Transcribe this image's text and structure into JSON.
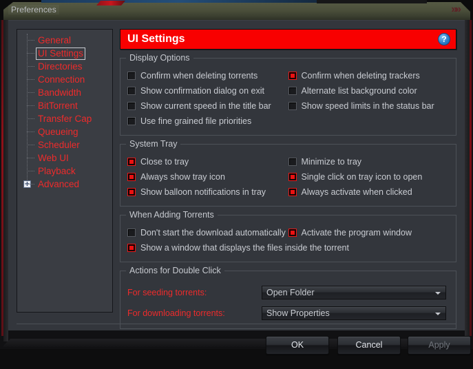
{
  "window": {
    "title": "Preferences",
    "logo_glyph": "»»"
  },
  "sidebar": {
    "items": [
      {
        "label": "General",
        "selected": false,
        "expandable": false
      },
      {
        "label": "UI Settings",
        "selected": true,
        "expandable": false
      },
      {
        "label": "Directories",
        "selected": false,
        "expandable": false
      },
      {
        "label": "Connection",
        "selected": false,
        "expandable": false
      },
      {
        "label": "Bandwidth",
        "selected": false,
        "expandable": false
      },
      {
        "label": "BitTorrent",
        "selected": false,
        "expandable": false
      },
      {
        "label": "Transfer Cap",
        "selected": false,
        "expandable": false
      },
      {
        "label": "Queueing",
        "selected": false,
        "expandable": false
      },
      {
        "label": "Scheduler",
        "selected": false,
        "expandable": false
      },
      {
        "label": "Web UI",
        "selected": false,
        "expandable": false
      },
      {
        "label": "Playback",
        "selected": false,
        "expandable": false
      },
      {
        "label": "Advanced",
        "selected": false,
        "expandable": true,
        "expander": "+"
      }
    ]
  },
  "banner": {
    "title": "UI Settings",
    "help_icon": "?",
    "color": "#f80000"
  },
  "groups": [
    {
      "legend": "Display Options",
      "layout": "two-column",
      "options": [
        {
          "label": "Confirm when deleting torrents",
          "checked": false,
          "full": false
        },
        {
          "label": "Confirm when deleting trackers",
          "checked": true,
          "full": false
        },
        {
          "label": "Show confirmation dialog on exit",
          "checked": false,
          "full": false
        },
        {
          "label": "Alternate list background color",
          "checked": false,
          "full": false
        },
        {
          "label": "Show current speed in the title bar",
          "checked": false,
          "full": false
        },
        {
          "label": "Show speed limits in the status bar",
          "checked": false,
          "full": false
        },
        {
          "label": "Use fine grained file priorities",
          "checked": false,
          "full": false
        }
      ]
    },
    {
      "legend": "System Tray",
      "layout": "two-column",
      "options": [
        {
          "label": "Close to tray",
          "checked": true,
          "full": false
        },
        {
          "label": "Minimize to tray",
          "checked": false,
          "full": false
        },
        {
          "label": "Always show tray icon",
          "checked": true,
          "full": false
        },
        {
          "label": "Single click on tray icon to open",
          "checked": true,
          "full": false
        },
        {
          "label": "Show balloon notifications in tray",
          "checked": true,
          "full": false
        },
        {
          "label": "Always activate when clicked",
          "checked": true,
          "full": false
        }
      ]
    },
    {
      "legend": "When Adding Torrents",
      "layout": "two-column",
      "options": [
        {
          "label": "Don't start the download automatically",
          "checked": false,
          "full": false
        },
        {
          "label": "Activate the program window",
          "checked": true,
          "full": false
        },
        {
          "label": "Show a window that displays the files inside the torrent",
          "checked": true,
          "full": true
        }
      ]
    }
  ],
  "double_click": {
    "legend": "Actions for Double Click",
    "rows": [
      {
        "label": "For seeding torrents:",
        "value": "Open Folder"
      },
      {
        "label": "For downloading torrents:",
        "value": "Show Properties"
      }
    ]
  },
  "buttons": {
    "ok": "OK",
    "cancel": "Cancel",
    "apply": "Apply"
  }
}
